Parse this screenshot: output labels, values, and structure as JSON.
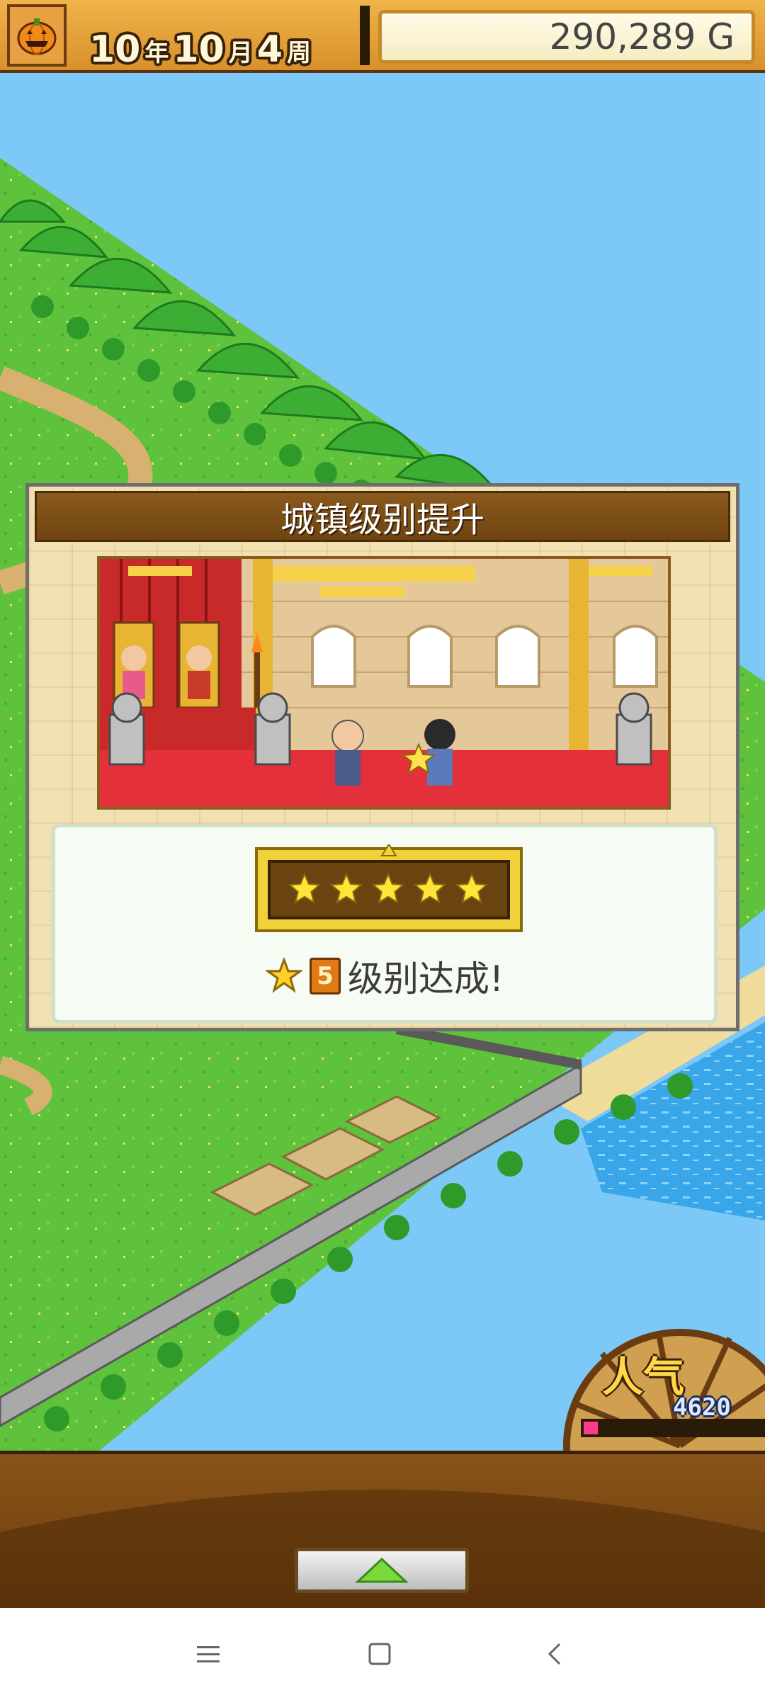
{
  "header": {
    "year": "10",
    "year_unit": "年",
    "month": "10",
    "month_unit": "月",
    "week": "4",
    "week_unit": "周",
    "money": "290,289 G",
    "icon": "pumpkin-icon"
  },
  "dialog": {
    "title": "城镇级别提升",
    "rating_stars": 5,
    "level_number": "5",
    "level_text": "级别达成!"
  },
  "popularity": {
    "label": "人气",
    "value": "4620",
    "fill": 0.08
  },
  "bottom": {
    "expand_icon": "triangle-up-icon"
  },
  "navbar": {
    "menu_icon": "menu-icon",
    "home_icon": "home-square-icon",
    "back_icon": "back-chevron-icon"
  },
  "colors": {
    "sky": "#7cc8f6",
    "grass": "#5ec23c",
    "title_bar": "#7a4c16",
    "money_text": "#444444"
  }
}
